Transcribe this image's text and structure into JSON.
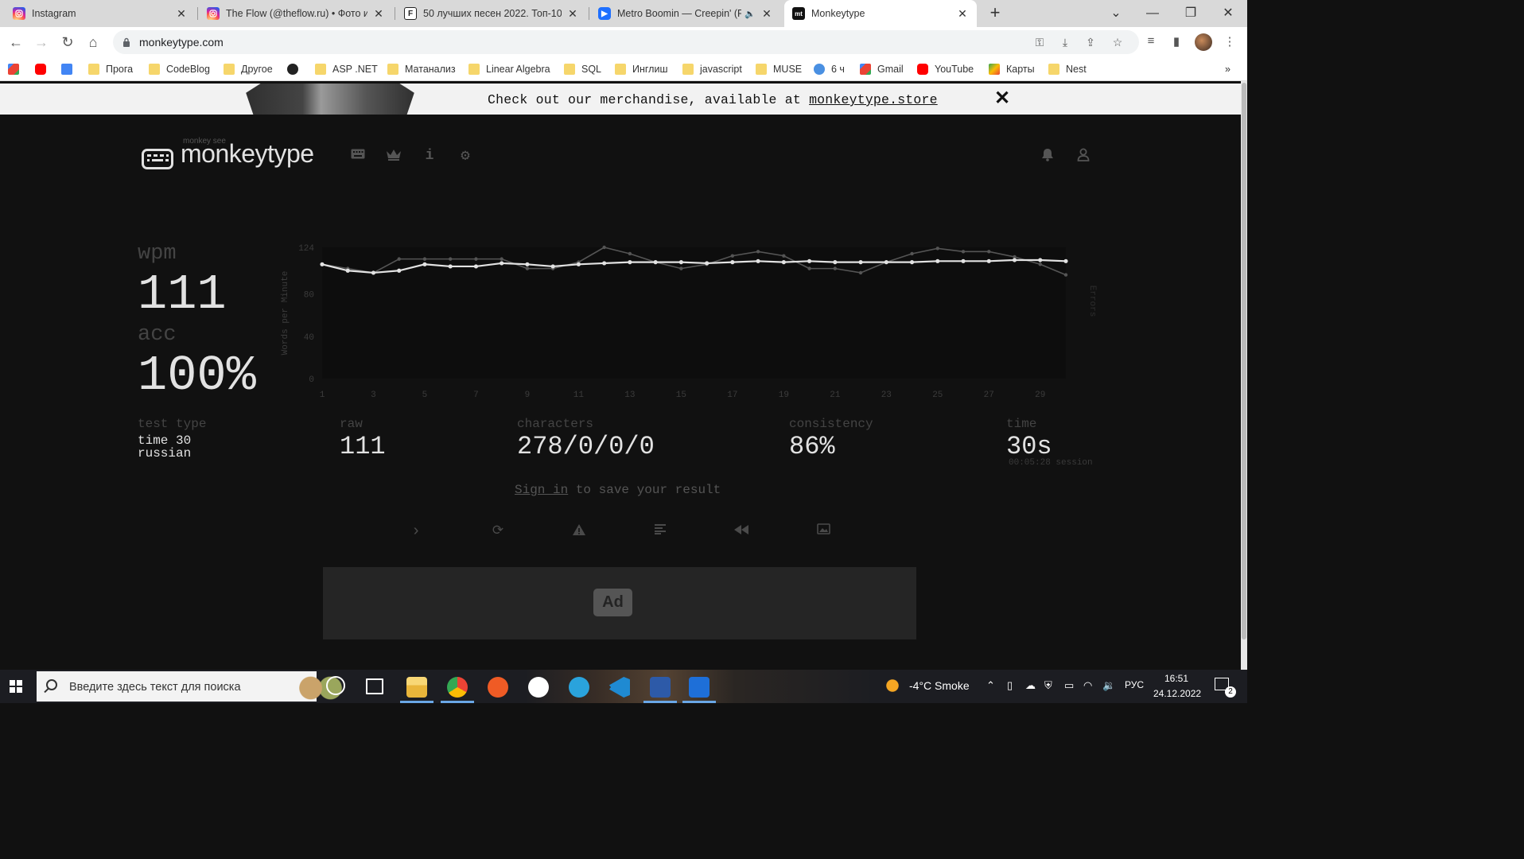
{
  "browser": {
    "tabs": [
      {
        "title": "Instagram",
        "favicon": "instagram-icon",
        "color": "#d6249f"
      },
      {
        "title": "The Flow (@theflow.ru) • Фото и",
        "favicon": "instagram-icon",
        "color": "#d6249f"
      },
      {
        "title": "50 лучших песен 2022. Топ-10",
        "favicon": "the-flow-icon",
        "color": "#222222"
      },
      {
        "title": "Metro Boomin — Creepin' (F",
        "favicon": "player-icon",
        "color": "#1e6fff",
        "audio": "🔈"
      },
      {
        "title": "Monkeytype",
        "favicon": "monkeytype-icon",
        "color": "#111111",
        "active": true
      }
    ],
    "new_tab": "+",
    "window_controls": {
      "tab_search": "⌄",
      "minimize": "—",
      "restore": "❐",
      "close": "✕"
    },
    "url": "monkeytype.com",
    "bookmarks": [
      {
        "label": "",
        "icon": "gmail-icon",
        "color": "#ea4335"
      },
      {
        "label": "",
        "icon": "youtube-icon",
        "color": "#ff0000"
      },
      {
        "label": "",
        "icon": "translate-icon",
        "color": "#4285f4"
      },
      {
        "label": "Прога",
        "icon": "folder-icon"
      },
      {
        "label": "CodeBlog",
        "icon": "folder-icon"
      },
      {
        "label": "Другое",
        "icon": "folder-icon"
      },
      {
        "label": "",
        "icon": "github-icon",
        "color": "#222222"
      },
      {
        "label": "ASP .NET",
        "icon": "folder-icon"
      },
      {
        "label": "Матанализ",
        "icon": "folder-icon"
      },
      {
        "label": "Linear Algebra",
        "icon": "folder-icon"
      },
      {
        "label": "SQL",
        "icon": "folder-icon"
      },
      {
        "label": "Инглиш",
        "icon": "folder-icon"
      },
      {
        "label": "javascript",
        "icon": "folder-icon"
      },
      {
        "label": "MUSE",
        "icon": "folder-icon"
      },
      {
        "label": "6 ч",
        "icon": "clock-icon",
        "color": "#4a90e2"
      },
      {
        "label": "Gmail",
        "icon": "gmail-icon",
        "color": "#ea4335"
      },
      {
        "label": "YouTube",
        "icon": "youtube-icon",
        "color": "#ff0000"
      },
      {
        "label": "Карты",
        "icon": "maps-icon",
        "color": "#34a853"
      },
      {
        "label": "Nest",
        "icon": "folder-icon"
      }
    ],
    "bookmarks_overflow": "»"
  },
  "banner": {
    "text": "Check out our merchandise, available at ",
    "link": "monkeytype.store",
    "close": "✕"
  },
  "header": {
    "sup": "monkey see",
    "logo": "monkeytype",
    "nav": [
      "keyboard-icon",
      "crown-icon",
      "info-icon",
      "settings-icon"
    ],
    "right": [
      "bell-icon",
      "user-icon"
    ]
  },
  "result": {
    "wpm_label": "wpm",
    "wpm": "111",
    "acc_label": "acc",
    "acc": "100%",
    "test_type_label": "test type",
    "test_type_lines": [
      "time 30",
      "russian"
    ],
    "raw_label": "raw",
    "raw": "111",
    "characters_label": "characters",
    "characters": "278/0/0/0",
    "consistency_label": "consistency",
    "consistency": "86%",
    "time_label": "time",
    "time": "30s",
    "session": "00:05:28 session",
    "signin_link": "Sign in",
    "signin_rest": " to save your result",
    "actions": [
      "next-test-icon",
      "restart-icon",
      "report-icon",
      "words-history-icon",
      "replay-icon",
      "screenshot-icon"
    ],
    "ad": "Ad"
  },
  "chart_data": {
    "type": "line",
    "ylabel": "Words per Minute",
    "y2label": "Errors",
    "ylim": [
      0,
      124
    ],
    "yticks": [
      "124",
      "80",
      "40",
      "0"
    ],
    "x": [
      1,
      2,
      3,
      4,
      5,
      6,
      7,
      8,
      9,
      10,
      11,
      12,
      13,
      14,
      15,
      16,
      17,
      18,
      19,
      20,
      21,
      22,
      23,
      24,
      25,
      26,
      27,
      28,
      29,
      30
    ],
    "xtick_labels": [
      "1",
      "3",
      "5",
      "7",
      "9",
      "11",
      "13",
      "15",
      "17",
      "19",
      "21",
      "23",
      "25",
      "27",
      "29"
    ],
    "series": [
      {
        "name": "wpm",
        "color": "#e2e2e2",
        "values": [
          108,
          102,
          100,
          102,
          108,
          106,
          106,
          109,
          108,
          106,
          108,
          109,
          110,
          110,
          110,
          109,
          110,
          111,
          110,
          111,
          110,
          110,
          110,
          110,
          111,
          111,
          111,
          112,
          112,
          111
        ]
      },
      {
        "name": "raw",
        "color": "#555555",
        "values": [
          108,
          104,
          100,
          113,
          113,
          113,
          113,
          113,
          104,
          104,
          110,
          124,
          118,
          110,
          104,
          108,
          116,
          120,
          116,
          104,
          104,
          100,
          110,
          118,
          123,
          120,
          120,
          115,
          108,
          98
        ]
      }
    ],
    "grid": false,
    "legend": "none",
    "colors": {
      "bg": "#0d0d0d",
      "axis_text": "#3c3c3c"
    }
  },
  "taskbar": {
    "search_placeholder": "Введите здесь текст для поиска",
    "apps": [
      "cortana-icon",
      "task-view-icon",
      "file-explorer-icon",
      "chrome-icon",
      "postman-icon",
      "mongodb-icon",
      "telegram-icon",
      "vscode-icon",
      "powershell-icon",
      "media-player-icon"
    ],
    "weather": "-4°C  Smoke",
    "lang": "РУС",
    "time": "16:51",
    "date": "24.12.2022",
    "notifications": "2"
  }
}
